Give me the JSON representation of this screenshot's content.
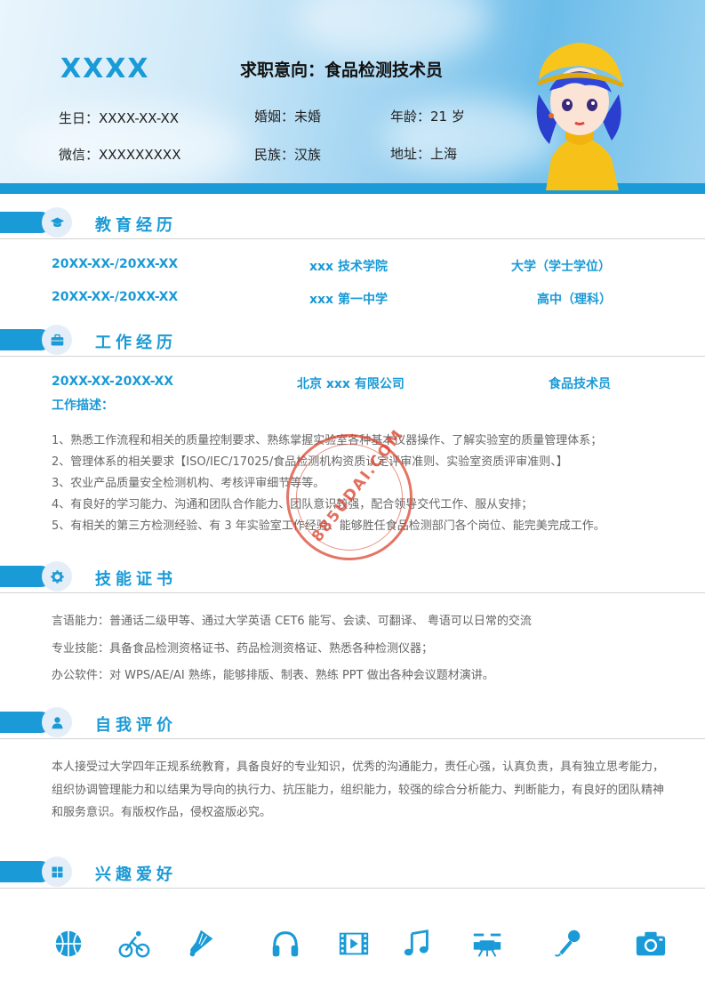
{
  "header": {
    "name": "XXXX",
    "intent": "求职意向：食品检测技术员",
    "birthday": "生日：XXXX-XX-XX",
    "marriage": "婚姻：未婚",
    "age": "年龄：21 岁",
    "wechat": "微信：XXXXXXXXX",
    "ethnicity": "民族：汉族",
    "address": "地址：上海"
  },
  "sections": {
    "education": "教育经历",
    "work": "工作经历",
    "skills": "技能证书",
    "self": "自我评价",
    "hobbies": "兴趣爱好"
  },
  "education": [
    {
      "date": "20XX-XX-/20XX-XX",
      "school": "xxx 技术学院",
      "degree": "大学（学士学位）"
    },
    {
      "date": "20XX-XX-/20XX-XX",
      "school": "xxx 第一中学",
      "degree": "高中（理科）"
    }
  ],
  "work": {
    "date": "20XX-XX-20XX-XX",
    "company": "北京 xxx 有限公司",
    "position": "食品技术员",
    "desc_label": "工作描述：",
    "items": [
      "1、熟悉工作流程和相关的质量控制要求、熟练掌握实验室各种基本仪器操作、了解实验室的质量管理体系；",
      "2、管理体系的相关要求【ISO/IEC/17025/食品检测机构资质认定评审准则、实验室资质评审准则、】",
      "3、农业产品质量安全检测机构、考核评审细节等等。",
      "4、有良好的学习能力、沟通和团队合作能力、团队意识较强，配合领导交代工作、服从安排；",
      "5、有相关的第三方检测经验、有 3 年实验室工作经验、能够胜任食品检测部门各个岗位、能完美完成工作。"
    ]
  },
  "skills": [
    {
      "label": "言语能力：",
      "text": "普通话二级甲等、通过大学英语 CET6 能写、会读、可翻译、 粤语可以日常的交流"
    },
    {
      "label": "专业技能：",
      "text": "具备食品检测资格证书、药品检测资格证、熟悉各种检测仪器；"
    },
    {
      "label": "办公软件：",
      "text": "对 WPS/AE/AI 熟练，能够排版、制表、熟练 PPT 做出各种会议题材演讲。"
    }
  ],
  "self_eval": "本人接受过大学四年正规系统教育，具备良好的专业知识，优秀的沟通能力，责任心强，认真负责，具有独立思考能力，组织协调管理能力和以结果为导向的执行力、抗压能力，组织能力，较强的综合分析能力、判断能力，有良好的团队精神和服务意识。有版权作品，侵权盗版必究。",
  "watermark": "885UDAI.COM",
  "hobby_icons": [
    "basketball-icon",
    "cycling-icon",
    "badminton-icon",
    "headphones-icon",
    "film-icon",
    "music-note-icon",
    "drums-icon",
    "microphone-icon",
    "camera-icon"
  ],
  "colors": {
    "accent": "#1a9ad6",
    "text": "#666666",
    "stamp": "#dc4632"
  }
}
